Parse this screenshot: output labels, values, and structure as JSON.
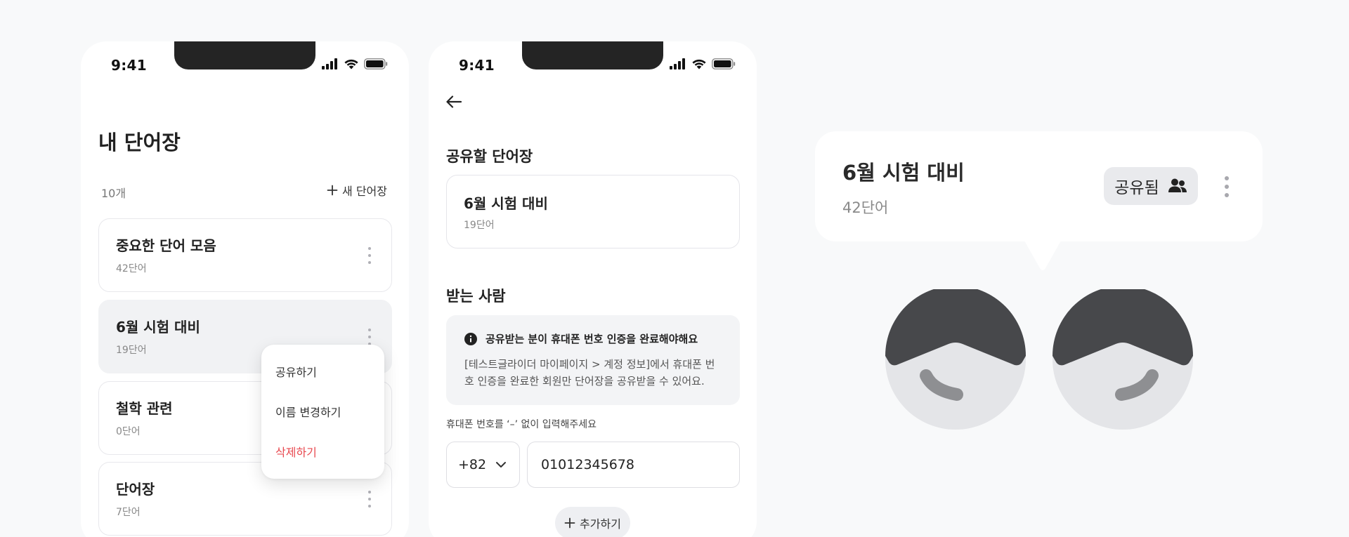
{
  "status_bar": {
    "time": "9:41"
  },
  "screen1": {
    "title": "내 단어장",
    "count": "10개",
    "new_button": "새 단어장",
    "cards": [
      {
        "title": "중요한 단어 모음",
        "subtitle": "42단어"
      },
      {
        "title": "6월 시험 대비",
        "subtitle": "19단어"
      },
      {
        "title": "철학 관련",
        "subtitle": "0단어"
      },
      {
        "title": "단어장",
        "subtitle": "7단어"
      }
    ],
    "context_menu": {
      "share": "공유하기",
      "rename": "이름 변경하기",
      "delete": "삭제하기"
    }
  },
  "screen2": {
    "share_section_title": "공유할 단어장",
    "share_card": {
      "title": "6월 시험 대비",
      "subtitle": "19단어"
    },
    "recipient_section_title": "받는 사람",
    "info_title": "공유받는 분이 휴대폰 번호 인증을 완료해야해요",
    "info_body": "[테스트글라이더 마이페이지 > 계정 정보]에서 휴대폰 번호 인증을 완료한 회원만 단어장을 공유받을 수 있어요.",
    "phone_hint": "휴대폰 번호를 ‘–’ 없이 입력해주세요",
    "country_code": "+82",
    "phone_value": "01012345678",
    "add_button": "추가하기"
  },
  "illustration": {
    "card_title": "6월 시험 대비",
    "card_subtitle": "42단어",
    "badge_label": "공유됨"
  },
  "colors": {
    "background": "#f8f9fa",
    "danger": "#e8484f",
    "illustration_dark": "#47484b",
    "illustration_light": "#e4e5e8",
    "illustration_mid": "#8e8f92"
  },
  "icons": [
    "signal-icon",
    "wifi-icon",
    "battery-icon",
    "plus-icon",
    "kebab-icon",
    "back-arrow-icon",
    "info-icon",
    "chevron-down-icon",
    "users-icon",
    "cursor-hand-icon"
  ]
}
